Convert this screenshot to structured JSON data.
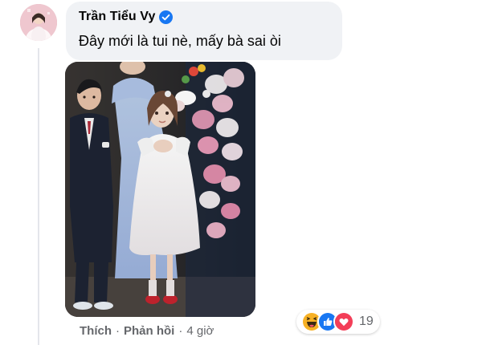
{
  "comment": {
    "author": "Trần Tiểu Vy",
    "text": "Đây mới là tui nè, mấy bà sai òi",
    "verified": true
  },
  "actions": {
    "like_label": "Thích",
    "separator": "·",
    "reply_label": "Phản hồi",
    "time": "4 giờ"
  },
  "reactions": {
    "icons": [
      "haha-icon",
      "like-icon",
      "love-icon"
    ],
    "count": "19"
  },
  "colors": {
    "verified": "#1877f2",
    "bubble": "#f0f2f5",
    "secondary_text": "#65676b",
    "like": "#1877f2",
    "love": "#f33e58",
    "haha": "#f7b125"
  }
}
